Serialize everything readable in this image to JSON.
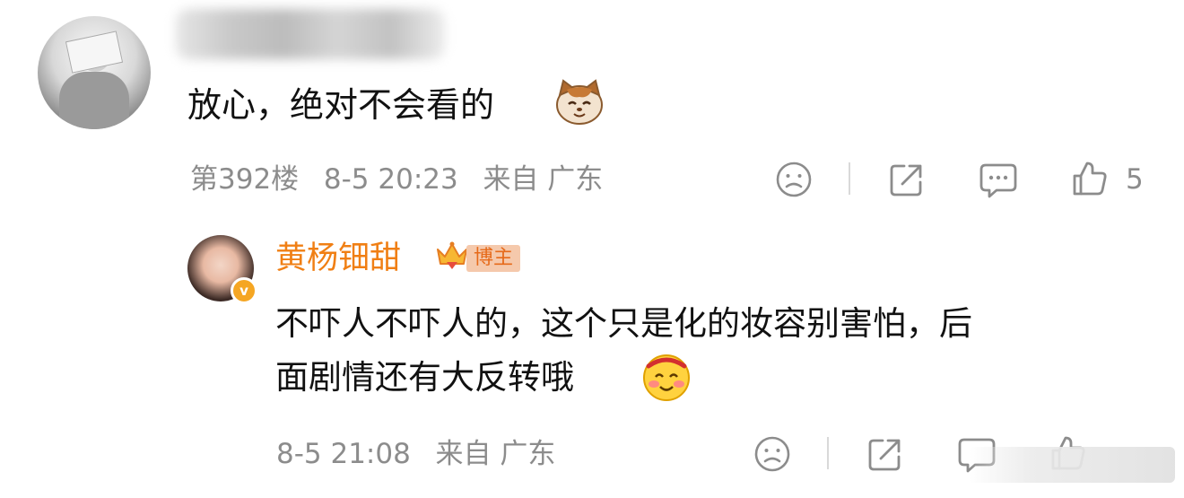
{
  "comment": {
    "text": "放心，绝对不会看的",
    "emoji": "cat-face-emoji",
    "floor": "第392楼",
    "time": "8-5 20:23",
    "location": "来自 广东",
    "like_count": "5"
  },
  "reply": {
    "author": "黄杨钿甜",
    "badge": "博主",
    "text_line1": "不吓人不吓人的，这个只是化的妆容别害怕，后",
    "text_line2": "面剧情还有大反转哦",
    "emoji": "blushing-face-emoji",
    "time": "8-5 21:08",
    "location": "来自 广东",
    "verified_mark": "v"
  },
  "colors": {
    "accent": "#f07f14",
    "meta_gray": "#8c8c8c",
    "badge_bg": "#f5c9ac",
    "verified": "#f5a623"
  }
}
